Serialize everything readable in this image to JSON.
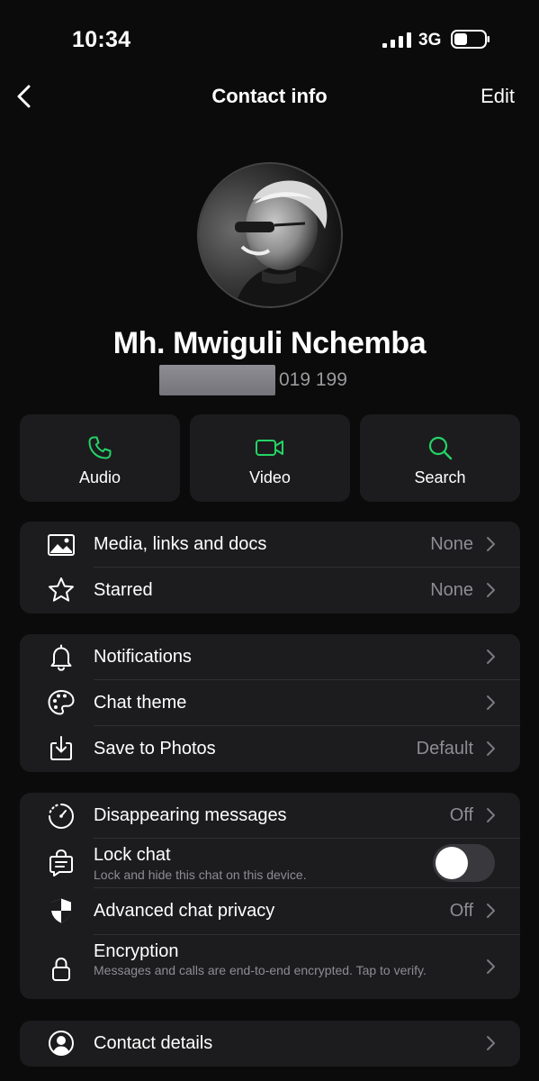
{
  "status_bar": {
    "time": "10:34",
    "network": "3G"
  },
  "nav": {
    "title": "Contact info",
    "edit_label": "Edit"
  },
  "contact": {
    "name": "Mh. Mwiguli Nchemba",
    "phone_visible_suffix": "019 199"
  },
  "actions": [
    {
      "label": "Audio",
      "icon": "phone-icon"
    },
    {
      "label": "Video",
      "icon": "video-camera-icon"
    },
    {
      "label": "Search",
      "icon": "search-icon"
    }
  ],
  "accent_color": "#25d366",
  "group1": [
    {
      "label": "Media, links and docs",
      "value": "None",
      "icon": "image-icon"
    },
    {
      "label": "Starred",
      "value": "None",
      "icon": "star-icon"
    }
  ],
  "group2": [
    {
      "label": "Notifications",
      "value": "",
      "icon": "bell-icon"
    },
    {
      "label": "Chat theme",
      "value": "",
      "icon": "palette-icon"
    },
    {
      "label": "Save to Photos",
      "value": "Default",
      "icon": "save-download-icon"
    }
  ],
  "group3": {
    "disappearing": {
      "label": "Disappearing messages",
      "value": "Off"
    },
    "lock_chat": {
      "label": "Lock chat",
      "subtitle": "Lock and hide this chat on this device.",
      "enabled": false
    },
    "advanced_privacy": {
      "label": "Advanced chat privacy",
      "value": "Off"
    },
    "encryption": {
      "label": "Encryption",
      "subtitle": "Messages and calls are end-to-end encrypted. Tap to verify."
    }
  },
  "group4": [
    {
      "label": "Contact details",
      "icon": "contact-icon"
    }
  ]
}
